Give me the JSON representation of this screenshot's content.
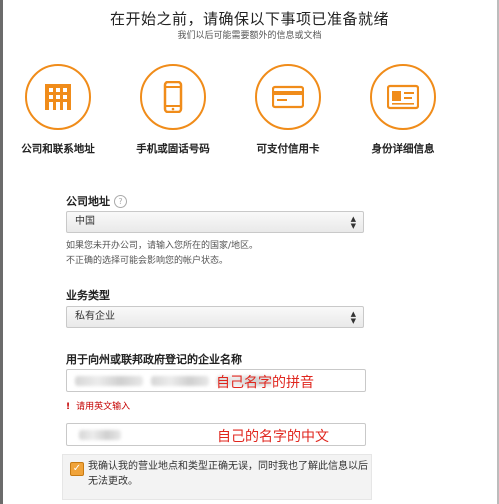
{
  "header": {
    "title": "在开始之前，请确保以下事项已准备就绪",
    "subtitle": "我们以后可能需要额外的信息或文档"
  },
  "requirements": [
    {
      "label": "公司和联系地址",
      "icon": "building-icon"
    },
    {
      "label": "手机或固话号码",
      "icon": "mobile-phone-icon"
    },
    {
      "label": "可支付信用卡",
      "icon": "credit-card-icon"
    },
    {
      "label": "身份详细信息",
      "icon": "id-card-icon"
    }
  ],
  "company_address": {
    "label": "公司地址",
    "help_icon": "?",
    "selected": "中国",
    "note_line1": "如果您未开办公司，请输入您所在的国家/地区。",
    "note_line2": "不正确的选择可能会影响您的帐户状态。"
  },
  "business_type": {
    "label": "业务类型",
    "selected": "私有企业"
  },
  "business_name": {
    "label": "用于向州或联邦政府登记的企业名称",
    "pinyin_annotation": "自己名字的拼音",
    "error_text": "请用英文输入",
    "chinese_annotation": "自己的名字的中文"
  },
  "confirmation": {
    "checked": true,
    "text": "我确认我的营业地点和类型正确无误，同时我也了解此信息以后无法更改。"
  },
  "colors": {
    "accent_orange": "#f08c1a",
    "annotation_red": "#e0261e",
    "error_red": "#c40000"
  }
}
